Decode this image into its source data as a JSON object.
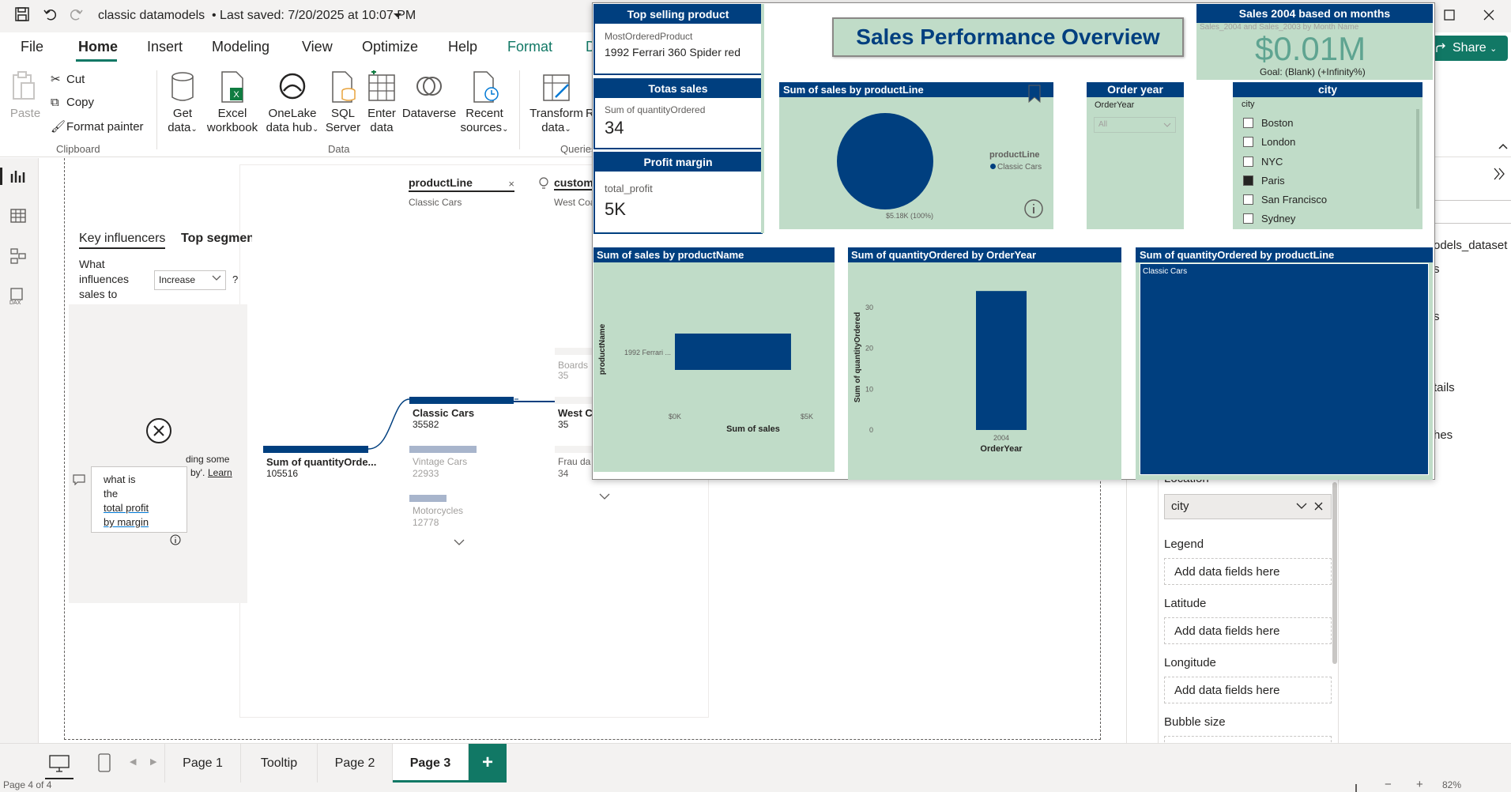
{
  "titlebar": {
    "file_name": "classic datamodels",
    "saved": "•  Last saved: 7/20/2025 at 10:07 PM"
  },
  "menu": [
    "File",
    "Home",
    "Insert",
    "Modeling",
    "View",
    "Optimize",
    "Help",
    "Format",
    "D"
  ],
  "share": "Share",
  "ribbon": {
    "paste": "Paste",
    "cut": "Cut",
    "copy": "Copy",
    "format_painter": "Format painter",
    "clipboard": "Clipboard",
    "get_data": [
      "Get",
      "data"
    ],
    "excel": [
      "Excel",
      "workbook"
    ],
    "onelake": [
      "OneLake",
      "data hub"
    ],
    "sql": [
      "SQL",
      "Server"
    ],
    "enter": [
      "Enter",
      "data"
    ],
    "dataverse": "Dataverse",
    "recent": [
      "Recent",
      "sources"
    ],
    "data_group": "Data",
    "transform": [
      "Transform",
      "data"
    ],
    "transform_r": "R",
    "queries": "Queries"
  },
  "ki": {
    "tab1": "Key influencers",
    "tab2": "Top segmen",
    "question": "What influences sales to",
    "dropdown": "Increase",
    "help": "?",
    "fragment1": "ding some",
    "fragment2": "by'.",
    "learn": "Learn",
    "qa": [
      "what is",
      "the",
      "total profit",
      "by margin"
    ]
  },
  "decomp": {
    "field1": "productLine",
    "field1_val": "Classic Cars",
    "field2": "custom",
    "field2_val": "West Coa",
    "root_label": "Sum of quantityOrde...",
    "root_value": "105516",
    "level1": [
      {
        "label": "Classic Cars",
        "value": "35582"
      },
      {
        "label": "Vintage Cars",
        "value": "22933"
      },
      {
        "label": "Motorcycles",
        "value": "12778"
      }
    ],
    "level2": [
      {
        "label": "Boards",
        "value": "35"
      },
      {
        "label": "West Co",
        "value": "35"
      },
      {
        "label": "Frau da",
        "value": "34"
      }
    ]
  },
  "cards": {
    "top_selling": {
      "title": "Top selling product",
      "field": "MostOrderedProduct",
      "value": "1992 Ferrari 360 Spider red"
    },
    "total_sales": {
      "title": "Totas sales",
      "field": "Sum of quantityOrdered",
      "value": "34"
    },
    "profit": {
      "title": "Profit margin",
      "field": "total_profit",
      "value": "5K"
    }
  },
  "report_title": "Sales Performance Overview",
  "kpi": {
    "title": "Sales 2004 based on months",
    "subtitle": "Sales_2004 and Sales_2003 by Month Name",
    "value": "$0.01M",
    "goal": "Goal: (Blank) (+Infinity%)"
  },
  "pie": {
    "title": "Sum of sales by productLine",
    "legend_title": "productLine",
    "legend_item": "Classic Cars",
    "slice_label": "$5.18K (100%)"
  },
  "order_year": {
    "title": "Order year",
    "label": "OrderYear",
    "value": "All"
  },
  "city": {
    "title": "city",
    "header": "city",
    "items": [
      {
        "name": "Boston",
        "checked": false
      },
      {
        "name": "London",
        "checked": false
      },
      {
        "name": "NYC",
        "checked": false
      },
      {
        "name": "Paris",
        "checked": true
      },
      {
        "name": "San Francisco",
        "checked": false
      },
      {
        "name": "Sydney",
        "checked": false
      }
    ]
  },
  "chart_data": [
    {
      "type": "bar",
      "title": "Sum of sales by productName",
      "categories": [
        "1992 Ferrari ..."
      ],
      "values": [
        4.4
      ],
      "xlabel": "Sum of sales",
      "ylabel": "productName",
      "ticks": [
        "$0K",
        "$5K"
      ],
      "xlim": [
        0,
        5
      ]
    },
    {
      "type": "bar",
      "title": "Sum of quantityOrdered by OrderYear",
      "categories": [
        "2004"
      ],
      "values": [
        34
      ],
      "xlabel": "OrderYear",
      "ylabel": "Sum of quantityOrdered",
      "ticks": [
        "0",
        "10",
        "20",
        "30"
      ],
      "ylim": [
        0,
        35
      ]
    },
    {
      "type": "treemap",
      "title": "Sum of quantityOrdered by productLine",
      "categories": [
        "Classic Cars"
      ],
      "values": [
        34
      ]
    }
  ],
  "right_pane": {
    "location": "Location",
    "location_value": "city",
    "legend": "Legend",
    "latitude": "Latitude",
    "longitude": "Longitude",
    "bubble": "Bubble size",
    "placeholder": "Add data fields here",
    "partial": [
      "odels_dataset",
      "s",
      "s",
      "tails",
      "hes"
    ]
  },
  "pages": [
    "Page 1",
    "Tooltip",
    "Page 2",
    "Page 3"
  ],
  "status": {
    "page": "Page 4 of 4",
    "zoom": "82%"
  },
  "colors": {
    "navy": "#003f7f",
    "green": "#c0dcc8",
    "ribbon_accent": "#117865"
  }
}
